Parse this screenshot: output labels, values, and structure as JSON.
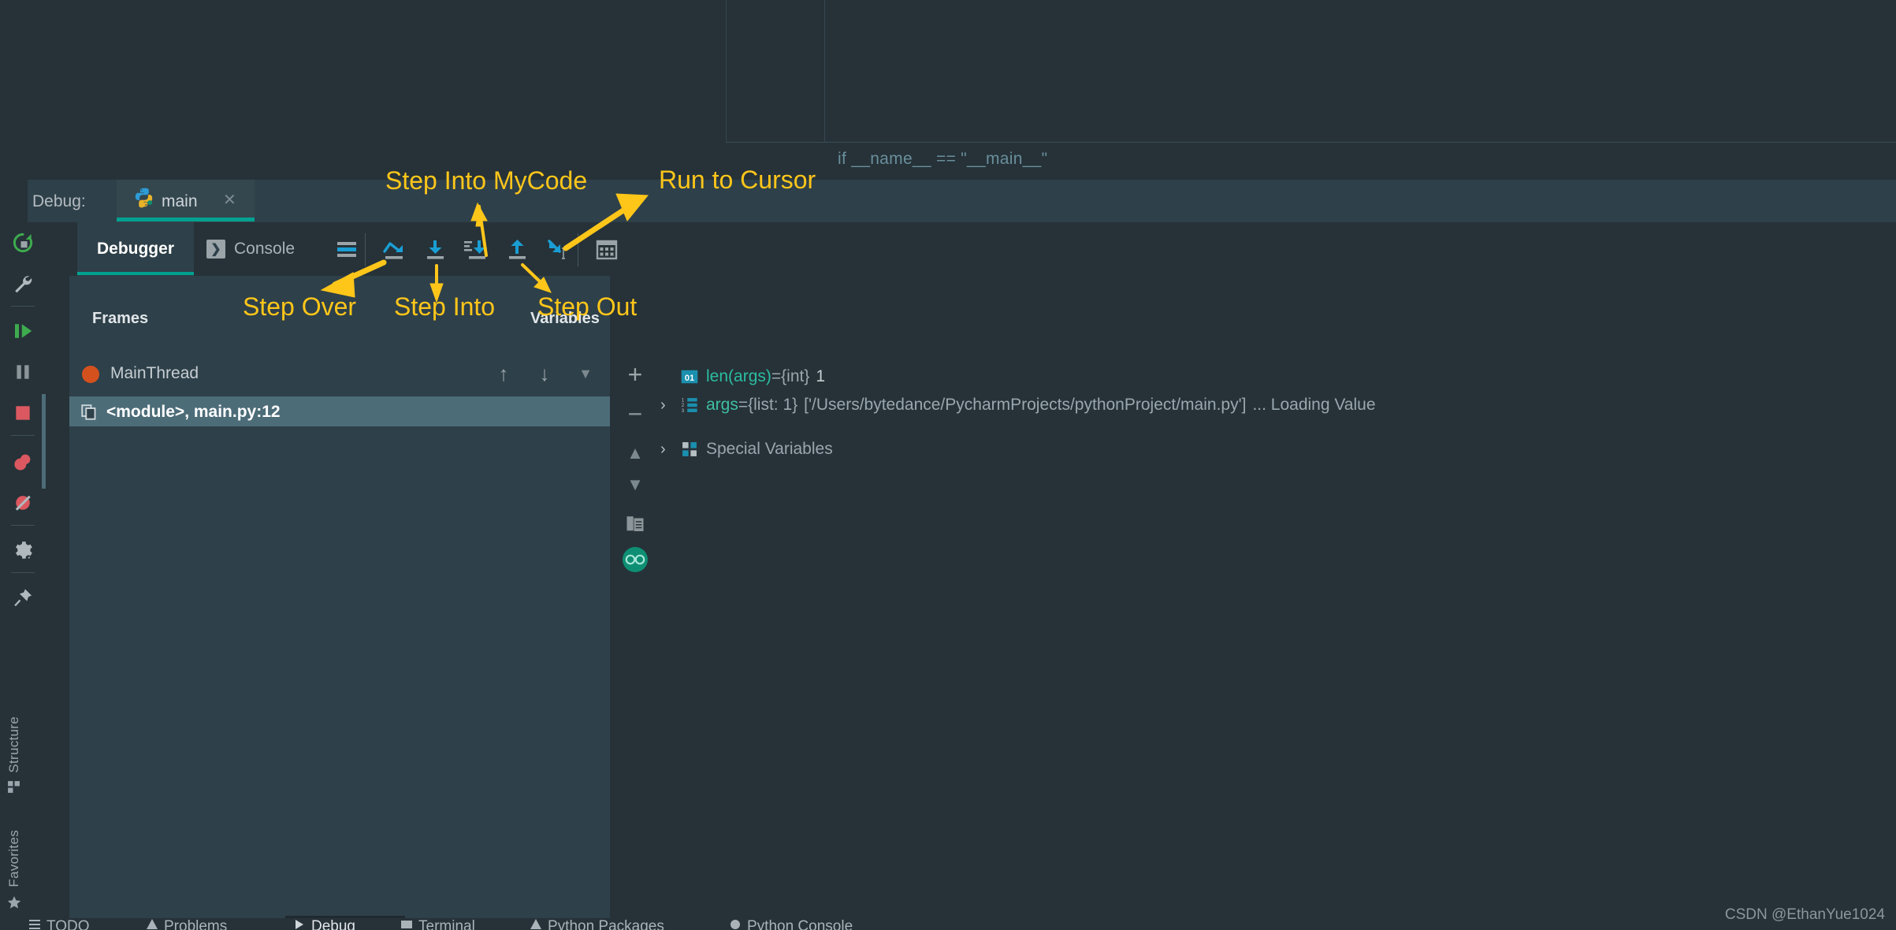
{
  "editor": {
    "code_line": "if __name__ == \"__main__\""
  },
  "debug_header": {
    "label": "Debug:",
    "run_tab_name": "main",
    "run_tab_icon": "python-icon",
    "close_icon": "close-icon"
  },
  "left_rail": {
    "items": [
      {
        "name": "rerun-icon",
        "title": "Rerun"
      },
      {
        "name": "settings-wrench-icon",
        "title": "Edit Configurations"
      },
      {
        "name": "resume-program-icon",
        "title": "Resume Program"
      },
      {
        "name": "pause-program-icon",
        "title": "Pause Program"
      },
      {
        "name": "stop-icon",
        "title": "Stop"
      },
      {
        "name": "view-breakpoints-icon",
        "title": "View Breakpoints"
      },
      {
        "name": "mute-breakpoints-icon",
        "title": "Mute Breakpoints"
      },
      {
        "name": "settings-gear-icon",
        "title": "Settings"
      },
      {
        "name": "pin-icon",
        "title": "Pin Tab"
      }
    ]
  },
  "stripe_buttons": [
    {
      "label": "Structure",
      "icon": "structure-icon"
    },
    {
      "label": "Favorites",
      "icon": "star-icon"
    }
  ],
  "tabs": {
    "debugger": "Debugger",
    "console": "Console",
    "console_icon": "console-icon"
  },
  "toolbar": {
    "buttons": [
      {
        "name": "show-execution-point-icon",
        "label": "Show Execution Point"
      },
      {
        "name": "step-over-icon",
        "label": "Step Over"
      },
      {
        "name": "step-into-icon",
        "label": "Step Into"
      },
      {
        "name": "step-into-my-code-icon",
        "label": "Step Into My Code"
      },
      {
        "name": "step-out-icon",
        "label": "Step Out"
      },
      {
        "name": "run-to-cursor-icon",
        "label": "Run to Cursor"
      },
      {
        "name": "evaluate-expression-icon",
        "label": "Evaluate Expression"
      }
    ]
  },
  "frames": {
    "title": "Frames",
    "thread": "MainThread",
    "thread_status_color": "#d4511e",
    "selected_frame": "<module>, main.py:12",
    "controls": [
      {
        "name": "frames-up-icon",
        "glyph": "↑"
      },
      {
        "name": "frames-down-icon",
        "glyph": "↓"
      },
      {
        "name": "frames-dropdown-icon",
        "glyph": "▼"
      }
    ]
  },
  "variables": {
    "title": "Variables",
    "gutter_buttons": [
      {
        "name": "add-watch-icon",
        "glyph": "+"
      },
      {
        "name": "remove-watch-icon",
        "glyph": "−"
      },
      {
        "name": "move-up-icon",
        "glyph": "▲"
      },
      {
        "name": "move-down-icon",
        "glyph": "▼"
      },
      {
        "name": "copy-value-icon",
        "glyph": "copy"
      },
      {
        "name": "inline-watches-icon",
        "glyph": "glasses"
      }
    ],
    "rows": [
      {
        "icon": "int-value-icon",
        "expandable": false,
        "name": "len(args)",
        "assign": " = ",
        "type": "{int}",
        "value": "1",
        "suffix": ""
      },
      {
        "icon": "list-value-icon",
        "expandable": true,
        "name": "args",
        "assign": " = ",
        "type": "{list: 1}",
        "value": "['/Users/bytedance/PycharmProjects/pythonProject/main.py']",
        "suffix": "... Loading Value"
      },
      {
        "icon": "special-variables-icon",
        "expandable": true,
        "name": "Special Variables",
        "assign": "",
        "type": "",
        "value": "",
        "suffix": ""
      }
    ]
  },
  "annotations": [
    {
      "text": "Step Into MyCode",
      "name": "annotation-step-into-my-code"
    },
    {
      "text": "Run to Cursor",
      "name": "annotation-run-to-cursor"
    },
    {
      "text": "Step Over",
      "name": "annotation-step-over"
    },
    {
      "text": "Step Into",
      "name": "annotation-step-into"
    },
    {
      "text": "Step Out",
      "name": "annotation-step-out"
    }
  ],
  "bottom_bar": {
    "items": [
      {
        "label": "TODO",
        "icon": "todo-icon"
      },
      {
        "label": "Problems",
        "icon": "problems-icon"
      },
      {
        "label": "Debug",
        "icon": "debug-icon"
      },
      {
        "label": "Terminal",
        "icon": "terminal-icon"
      },
      {
        "label": "Python Packages",
        "icon": "python-packages-icon"
      },
      {
        "label": "Python Console",
        "icon": "python-console-icon"
      }
    ]
  },
  "watermark": "CSDN @EthanYue1024",
  "colors": {
    "background": "#263238",
    "panel": "#2e4049",
    "selection": "#4c6c78",
    "accent_teal": "#00a191",
    "annotation_yellow": "#ffc61a",
    "step_blue": "#1a9ed4",
    "variable_teal": "#2bbda2"
  }
}
